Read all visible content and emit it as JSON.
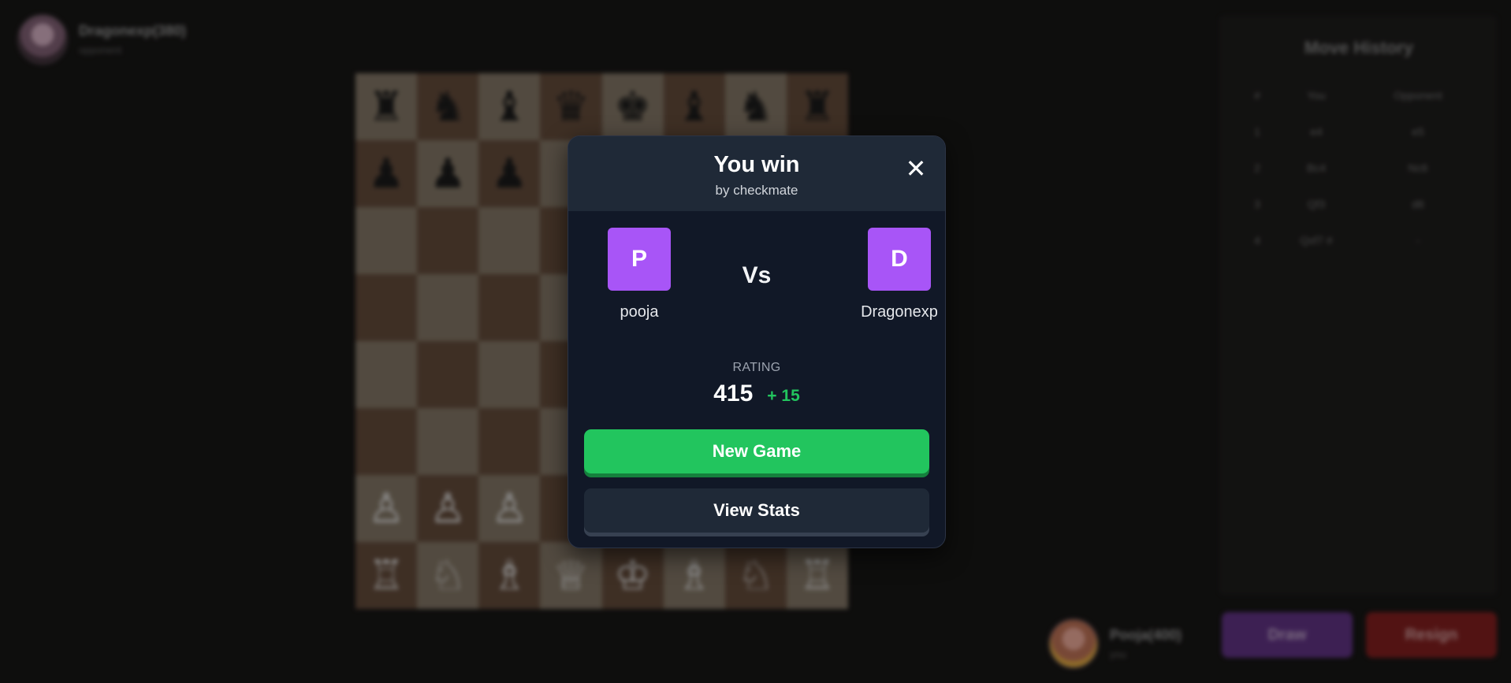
{
  "opponent": {
    "name": "Dragonexp(380)",
    "label": "opponent"
  },
  "me": {
    "name": "Pooja(400)",
    "rating_text": "you"
  },
  "board": {
    "rows": [
      [
        "♜",
        "♞",
        "♝",
        "♛",
        "♚",
        "♝",
        "♞",
        "♜"
      ],
      [
        "♟",
        "♟",
        "♟",
        "",
        "",
        "",
        "",
        ""
      ],
      [
        "",
        "",
        "",
        "",
        "",
        "",
        "",
        ""
      ],
      [
        "",
        "",
        "",
        "",
        "",
        "",
        "",
        ""
      ],
      [
        "",
        "",
        "",
        "",
        "",
        "",
        "",
        ""
      ],
      [
        "",
        "",
        "",
        "",
        "",
        "",
        "",
        ""
      ],
      [
        "♙",
        "♙",
        "♙",
        "",
        "",
        "",
        "",
        ""
      ],
      [
        "♖",
        "♘",
        "♗",
        "♕",
        "♔",
        "♗",
        "♘",
        "♖"
      ]
    ]
  },
  "move_history": {
    "title": "Move History",
    "headers": [
      "#",
      "You",
      "Opponent"
    ],
    "rows": [
      [
        "1",
        "e4",
        "e5"
      ],
      [
        "2",
        "Bc4",
        "Nc6"
      ],
      [
        "3",
        "Qf3",
        "d6"
      ],
      [
        "4",
        "Qxf7 #",
        "-"
      ]
    ]
  },
  "actions": {
    "draw": "Draw",
    "resign": "Resign"
  },
  "modal": {
    "title": "You win",
    "subtitle": "by checkmate",
    "close_glyph": "✕",
    "player_left": {
      "initial": "P",
      "name": "pooja"
    },
    "vs": "Vs",
    "player_right": {
      "initial": "D",
      "name": "Dragonexp"
    },
    "rating_label": "RATING",
    "rating_value": "415",
    "rating_delta": "+ 15",
    "new_game_label": "New Game",
    "view_stats_label": "View Stats"
  },
  "colors": {
    "accent_purple": "#a855f7",
    "success_green": "#22c55e",
    "modal_bg": "#111827",
    "modal_header_bg": "#1f2937"
  }
}
